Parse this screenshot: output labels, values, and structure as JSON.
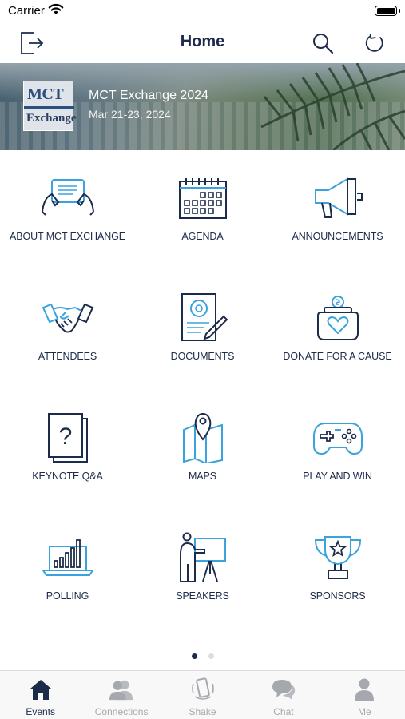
{
  "status_bar": {
    "carrier": "Carrier"
  },
  "nav": {
    "title": "Home",
    "left_icon": "logout-icon",
    "search_icon": "search-icon",
    "refresh_icon": "refresh-icon"
  },
  "banner": {
    "logo_top": "MCT",
    "logo_bottom": "Exchange",
    "title": "MCT Exchange 2024",
    "date": "Mar 21-23, 2024"
  },
  "tiles": [
    {
      "label": "ABOUT MCT EXCHANGE",
      "icon": "tablet-hands-icon"
    },
    {
      "label": "AGENDA",
      "icon": "calendar-icon"
    },
    {
      "label": "ANNOUNCEMENTS",
      "icon": "megaphone-icon"
    },
    {
      "label": "ATTENDEES",
      "icon": "handshake-icon"
    },
    {
      "label": "DOCUMENTS",
      "icon": "document-icon"
    },
    {
      "label": "DONATE FOR A CAUSE",
      "icon": "donation-jar-icon"
    },
    {
      "label": "KEYNOTE Q&A",
      "icon": "question-icon"
    },
    {
      "label": "MAPS",
      "icon": "map-icon"
    },
    {
      "label": "PLAY AND WIN",
      "icon": "gamepad-icon"
    },
    {
      "label": "POLLING",
      "icon": "laptop-chart-icon"
    },
    {
      "label": "SPEAKERS",
      "icon": "presenter-icon"
    },
    {
      "label": "SPONSORS",
      "icon": "trophy-icon"
    }
  ],
  "pager": {
    "pages": 2,
    "current": 1
  },
  "tabs": [
    {
      "label": "Events",
      "icon": "home-icon",
      "active": true
    },
    {
      "label": "Connections",
      "icon": "people-icon",
      "active": false
    },
    {
      "label": "Shake",
      "icon": "shake-phone-icon",
      "active": false
    },
    {
      "label": "Chat",
      "icon": "chat-icon",
      "active": false
    },
    {
      "label": "Me",
      "icon": "person-icon",
      "active": false
    }
  ],
  "colors": {
    "navy": "#1d2b4a",
    "blue": "#3aa3dd",
    "tab_inactive": "#a5a8ad"
  }
}
